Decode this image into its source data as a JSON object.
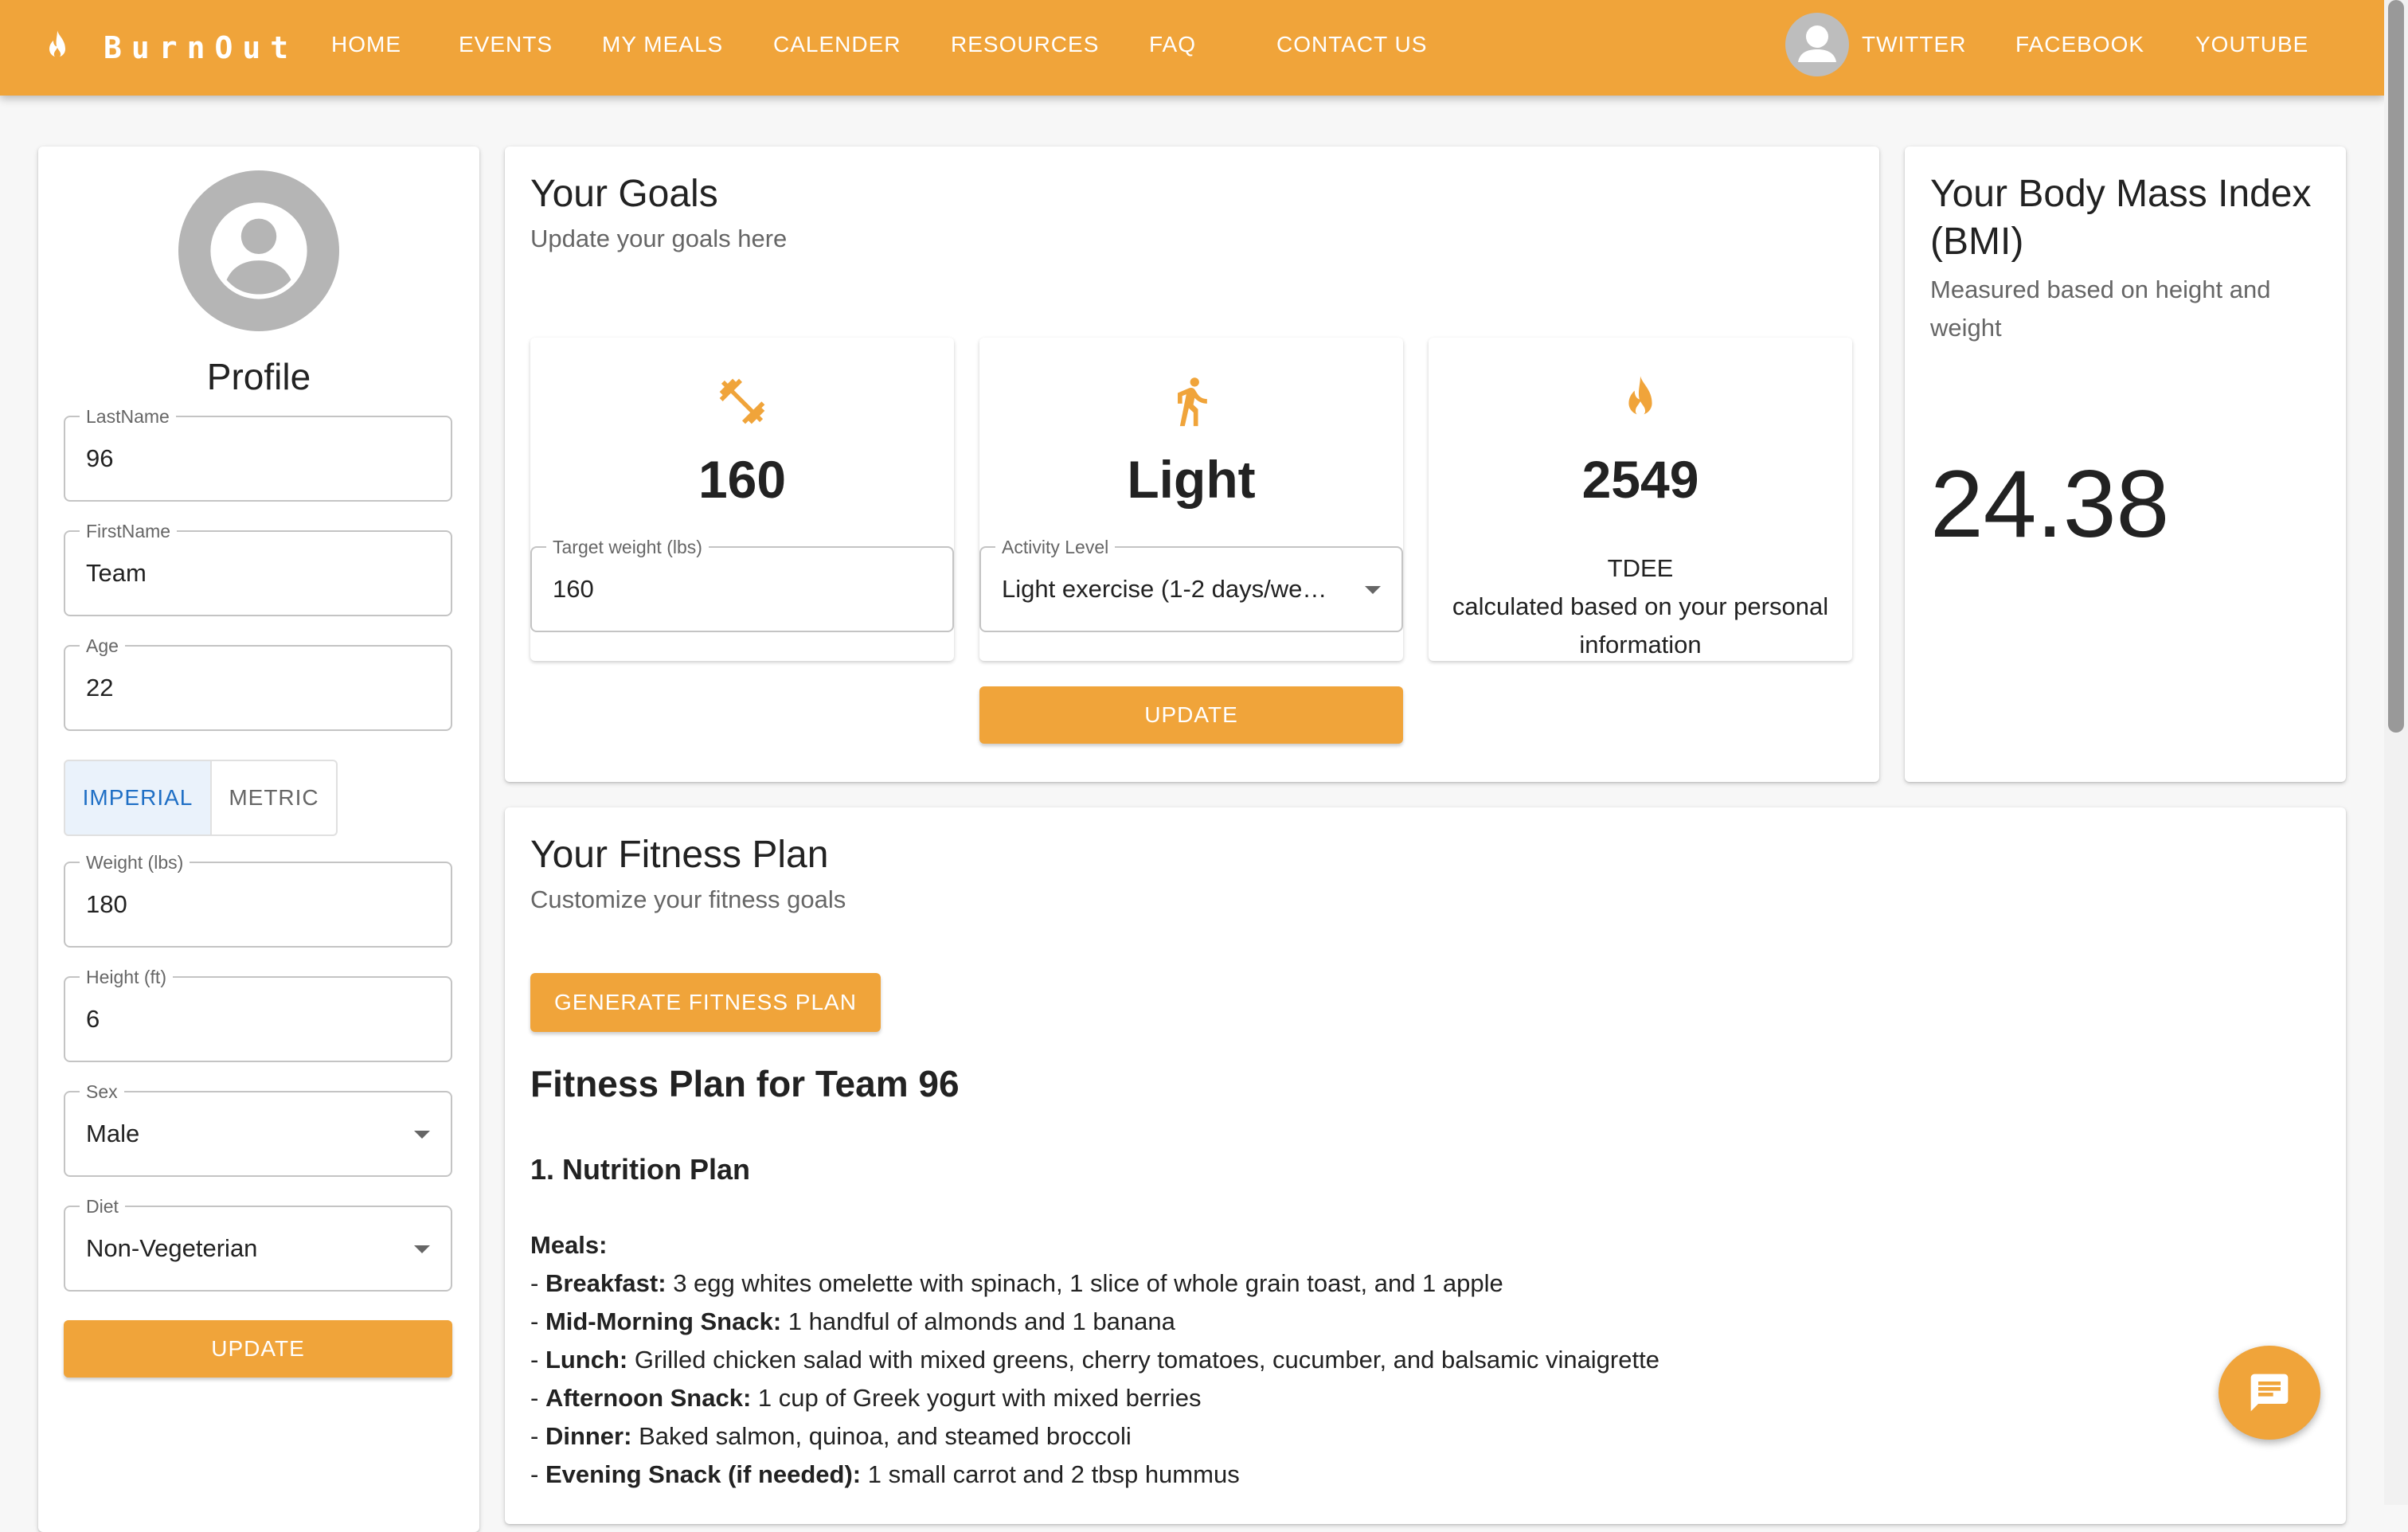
{
  "brand": {
    "name": "BurnOut",
    "icon": "flame-icon"
  },
  "nav": {
    "items": [
      "HOME",
      "EVENTS",
      "MY MEALS",
      "CALENDER",
      "RESOURCES",
      "FAQ",
      "CONTACT US"
    ],
    "social": [
      "TWITTER",
      "FACEBOOK",
      "YOUTUBE"
    ],
    "avatar_icon": "user-avatar-icon"
  },
  "colors": {
    "accent": "#f0a43a",
    "active_blue": "#1f6fc5"
  },
  "profile": {
    "title": "Profile",
    "lastname": {
      "label": "LastName",
      "value": "96"
    },
    "firstname": {
      "label": "FirstName",
      "value": "Team"
    },
    "age": {
      "label": "Age",
      "value": "22"
    },
    "units": {
      "imperial": "IMPERIAL",
      "metric": "METRIC",
      "selected": "IMPERIAL"
    },
    "weight": {
      "label": "Weight (lbs)",
      "value": "180"
    },
    "height": {
      "label": "Height (ft)",
      "value": "6"
    },
    "sex": {
      "label": "Sex",
      "value": "Male"
    },
    "diet": {
      "label": "Diet",
      "value": "Non-Vegeterian"
    },
    "update_label": "UPDATE"
  },
  "goals": {
    "title": "Your Goals",
    "subtitle": "Update your goals here",
    "weight_card": {
      "icon": "dumbbell-icon",
      "value": "160",
      "field_label": "Target weight (lbs)",
      "field_value": "160"
    },
    "activity_card": {
      "icon": "running-icon",
      "value": "Light",
      "field_label": "Activity Level",
      "field_value": "Light exercise (1-2 days/we…"
    },
    "tdee_card": {
      "icon": "flame-icon",
      "value": "2549",
      "label": "TDEE",
      "description": "calculated based on your personal information"
    },
    "update_label": "UPDATE"
  },
  "bmi": {
    "title": "Your Body Mass Index (BMI)",
    "subtitle": "Measured based on height and weight",
    "value": "24.38"
  },
  "plan": {
    "title": "Your Fitness Plan",
    "subtitle": "Customize your fitness goals",
    "generate_label": "GENERATE FITNESS PLAN",
    "heading": "Fitness Plan for Team 96",
    "section": "1. Nutrition Plan",
    "meals_label": "Meals:",
    "meals": [
      {
        "name": "Breakfast:",
        "text": "3 egg whites omelette with spinach, 1 slice of whole grain toast, and 1 apple"
      },
      {
        "name": "Mid-Morning Snack:",
        "text": "1 handful of almonds and 1 banana"
      },
      {
        "name": "Lunch:",
        "text": "Grilled chicken salad with mixed greens, cherry tomatoes, cucumber, and balsamic vinaigrette"
      },
      {
        "name": "Afternoon Snack:",
        "text": "1 cup of Greek yogurt with mixed berries"
      },
      {
        "name": "Dinner:",
        "text": "Baked salmon, quinoa, and steamed broccoli"
      },
      {
        "name": "Evening Snack (if needed):",
        "text": "1 small carrot and 2 tbsp hummus"
      }
    ]
  },
  "chat": {
    "icon": "chat-icon"
  }
}
